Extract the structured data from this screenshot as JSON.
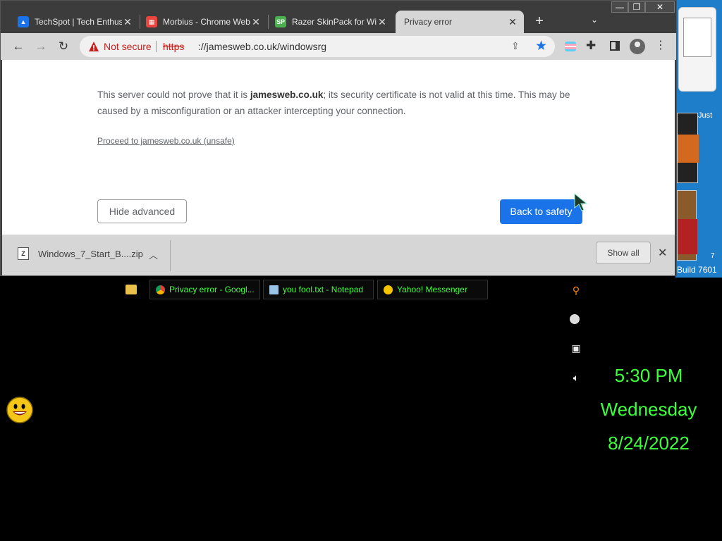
{
  "browser": {
    "tabs": [
      {
        "title": "TechSpot | Tech Enthusiasts",
        "favicon": "techspot-icon",
        "active": false
      },
      {
        "title": "Morbius - Chrome Web Store",
        "favicon": "store-icon",
        "active": false
      },
      {
        "title": "Razer SkinPack for Windows",
        "favicon": "skinpack-icon",
        "active": false
      },
      {
        "title": "Privacy error",
        "favicon": "",
        "active": true
      }
    ],
    "new_tab_label": "+",
    "window_controls": {
      "minimize": "—",
      "maximize": "❐",
      "close": "✕"
    },
    "address_bar": {
      "security_label": "Not secure",
      "url_scheme": "https",
      "url_rest": "://jamesweb.co.uk/windowsrg"
    },
    "page": {
      "explanation_prefix": "This server could not prove that it is ",
      "explanation_domain": "jamesweb.co.uk",
      "explanation_suffix": "; its security certificate is not valid at this time. This may be caused by a misconfiguration or an attacker intercepting your connection.",
      "proceed_link": "Proceed to jamesweb.co.uk (unsafe)",
      "hide_advanced": "Hide advanced",
      "back_to_safety": "Back to safety"
    },
    "download_bar": {
      "filename": "Windows_7_Start_B....zip",
      "show_all": "Show all"
    }
  },
  "taskbar": {
    "tasks": [
      {
        "label": "Privacy error - Googl...",
        "icon": "chrome-icon"
      },
      {
        "label": "you fool.txt - Notepad",
        "icon": "notepad-icon"
      },
      {
        "label": "Yahoo! Messenger",
        "icon": "yahoo-messenger-icon"
      }
    ]
  },
  "clock": {
    "time": "5:30 PM",
    "day": "Wednesday",
    "date": "8/24/2022"
  },
  "desktop": {
    "fragment_just": "Just",
    "fragment_build": "Build 7601",
    "fragment_7": "7"
  },
  "colors": {
    "clock_green": "#3cff3c",
    "accent_blue": "#1a73e8",
    "warning_red": "#c5221f"
  }
}
